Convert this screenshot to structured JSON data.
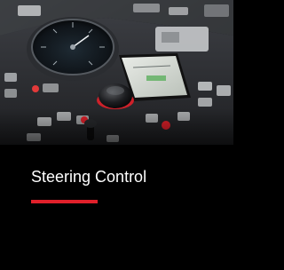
{
  "card": {
    "title": "Steering Control",
    "image_subject": "helm-console-photo"
  },
  "colors": {
    "background": "#000000",
    "title": "#ffffff",
    "accent": "#e0202a"
  }
}
